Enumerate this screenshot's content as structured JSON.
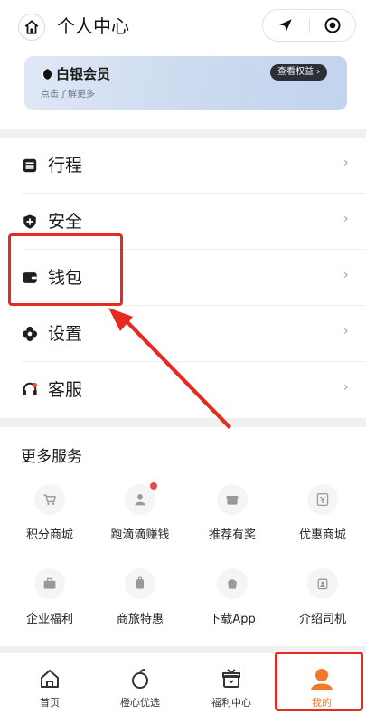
{
  "header": {
    "title": "个人中心",
    "home_icon": "home-icon",
    "location_icon": "location-arrow-icon",
    "target_icon": "target-circle-icon"
  },
  "member": {
    "level": "白银会员",
    "subtitle": "点击了解更多",
    "view_button": "查看权益",
    "chevron": "›"
  },
  "menu": [
    {
      "label": "行程",
      "icon": "itinerary-icon"
    },
    {
      "label": "安全",
      "icon": "shield-icon"
    },
    {
      "label": "钱包",
      "icon": "wallet-icon"
    },
    {
      "label": "设置",
      "icon": "gear-icon"
    },
    {
      "label": "客服",
      "icon": "headset-icon"
    }
  ],
  "chevron": "›",
  "services": {
    "title": "更多服务",
    "items": [
      {
        "label": "积分商城",
        "icon": "cart-icon"
      },
      {
        "label": "跑滴滴赚钱",
        "icon": "driver-icon",
        "badge": true
      },
      {
        "label": "推荐有奖",
        "icon": "gift-icon"
      },
      {
        "label": "优惠商城",
        "icon": "yen-icon"
      },
      {
        "label": "企业福利",
        "icon": "briefcase-icon"
      },
      {
        "label": "商旅特惠",
        "icon": "luggage-icon"
      },
      {
        "label": "下载App",
        "icon": "bag-icon"
      },
      {
        "label": "介绍司机",
        "icon": "person-plus-icon"
      }
    ]
  },
  "tabbar": [
    {
      "label": "首页",
      "icon": "home-outline-icon",
      "active": false
    },
    {
      "label": "橙心优选",
      "icon": "orange-icon",
      "active": false
    },
    {
      "label": "福利中心",
      "icon": "gift-box-icon",
      "active": false
    },
    {
      "label": "我的",
      "icon": "profile-icon",
      "active": true
    }
  ],
  "colors": {
    "accent": "#f07a2a",
    "annotation": "#e52a22",
    "badge": "#f04848"
  }
}
